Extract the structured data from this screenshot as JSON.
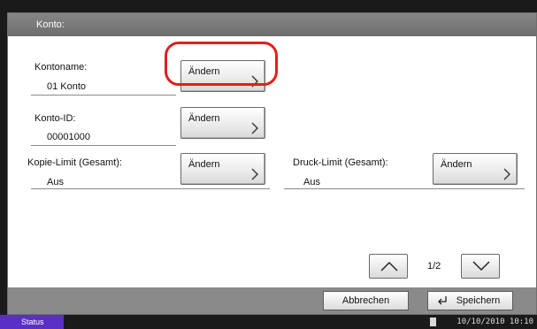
{
  "window": {
    "title": "Konto:"
  },
  "fields": [
    {
      "label": "Kontoname:",
      "value": "01 Konto",
      "button": "Ändern"
    },
    {
      "label": "Konto-ID:",
      "value": "00001000",
      "button": "Ändern"
    },
    {
      "label": "Kopie-Limit (Gesamt):",
      "value": "Aus",
      "button": "Ändern"
    },
    {
      "label": "Druck-Limit (Gesamt):",
      "value": "Aus",
      "button": "Ändern"
    }
  ],
  "pagination": {
    "current": "1/2"
  },
  "footer": {
    "cancel_label": "Abbrechen",
    "save_label": "Speichern"
  },
  "status_bar": {
    "status_label": "Status",
    "datetime": "10/10/2010  10:10"
  },
  "colors": {
    "highlight_ring": "#e0201c",
    "status_button": "#5a2fc7",
    "title_bar": "#777777"
  }
}
